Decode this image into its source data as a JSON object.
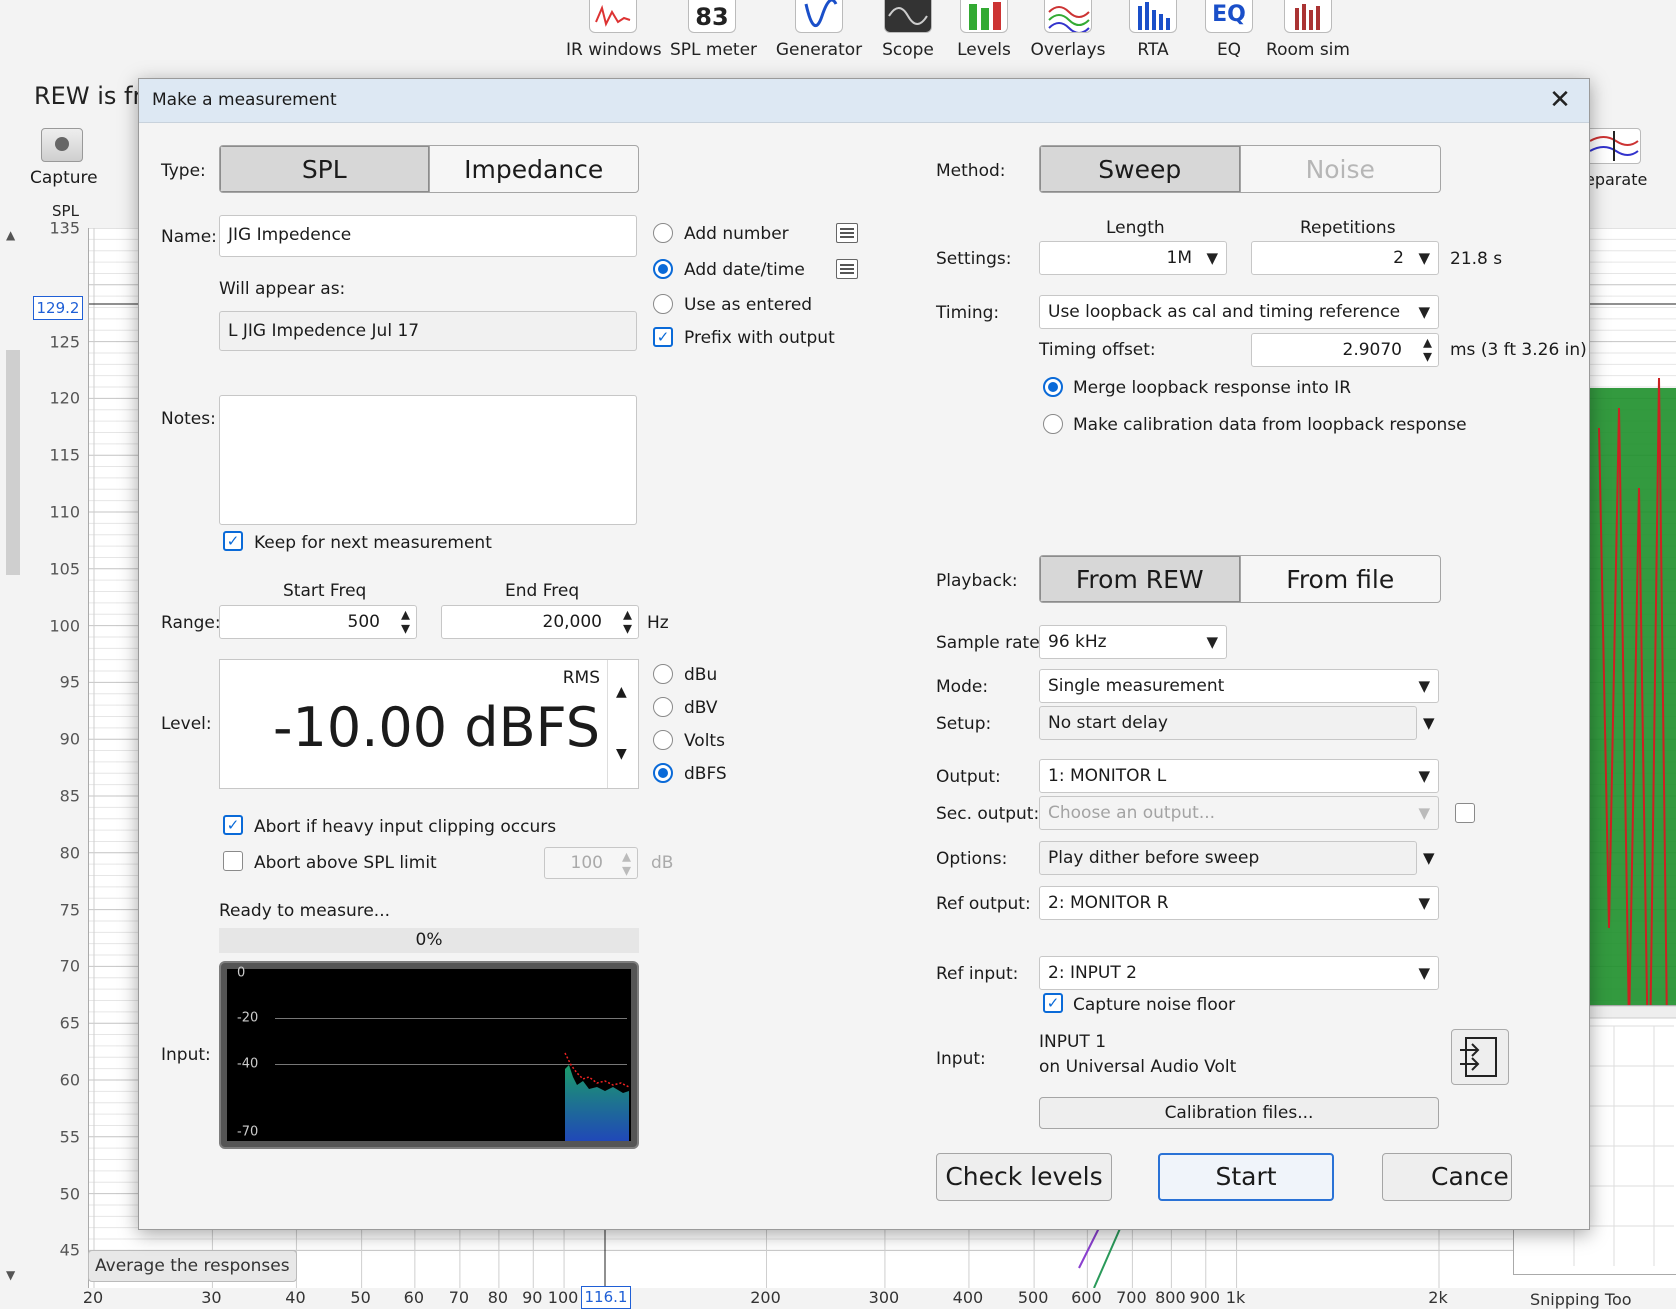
{
  "toolbar": {
    "items": [
      {
        "label": "IR windows",
        "icon": "ir-windows-icon"
      },
      {
        "label": "SPL meter",
        "icon": "spl-meter-icon",
        "value": "83"
      },
      {
        "label": "Generator",
        "icon": "generator-icon"
      },
      {
        "label": "Scope",
        "icon": "scope-icon"
      },
      {
        "label": "Levels",
        "icon": "levels-icon"
      },
      {
        "label": "Overlays",
        "icon": "overlays-icon"
      },
      {
        "label": "RTA",
        "icon": "rta-icon"
      },
      {
        "label": "EQ",
        "icon": "eq-icon"
      },
      {
        "label": "Room sim",
        "icon": "room-sim-icon"
      }
    ]
  },
  "background": {
    "banner": "REW is fr",
    "capture_label": "Capture",
    "separate_label": "eparate",
    "spl_label": "SPL",
    "cursor_y": "129.2",
    "cursor_x": "116.1",
    "average_button": "Average the responses",
    "y_ticks": [
      "135",
      "125",
      "120",
      "115",
      "110",
      "105",
      "100",
      "95",
      "90",
      "85",
      "80",
      "75",
      "70",
      "65",
      "60",
      "55",
      "50",
      "45"
    ],
    "x_ticks": [
      "20",
      "30",
      "40",
      "50",
      "60",
      "70",
      "80",
      "90",
      "100",
      "200",
      "300",
      "400",
      "500",
      "600",
      "700",
      "800",
      "900",
      "1k",
      "2k"
    ],
    "snipping_tool": "Snipping Too"
  },
  "dialog": {
    "title": "Make a measurement",
    "close": "✕",
    "type": {
      "label": "Type:",
      "options": [
        "SPL",
        "Impedance"
      ],
      "selected": "SPL"
    },
    "name": {
      "label": "Name:",
      "value": "JIG Impedence",
      "will_appear_label": "Will appear as:",
      "will_appear_value": "L JIG Impedence Jul 17"
    },
    "name_options": [
      {
        "label": "Add number",
        "checked": false
      },
      {
        "label": "Add date/time",
        "checked": true
      },
      {
        "label": "Use as entered",
        "checked": false
      }
    ],
    "prefix_with_output": {
      "label": "Prefix with output",
      "checked": true
    },
    "notes": {
      "label": "Notes:",
      "value": ""
    },
    "keep_for_next": {
      "label": "Keep for next measurement",
      "checked": true
    },
    "range": {
      "label": "Range:",
      "start_label": "Start Freq",
      "end_label": "End Freq",
      "start": "500",
      "end": "20,000",
      "unit": "Hz"
    },
    "level": {
      "label": "Level:",
      "mode": "RMS",
      "value": "-10.00 dBFS",
      "units": [
        {
          "label": "dBu",
          "checked": false
        },
        {
          "label": "dBV",
          "checked": false
        },
        {
          "label": "Volts",
          "checked": false
        },
        {
          "label": "dBFS",
          "checked": true
        }
      ]
    },
    "abort_clipping": {
      "label": "Abort if heavy input clipping occurs",
      "checked": true
    },
    "abort_spl": {
      "label": "Abort above SPL limit",
      "checked": false,
      "value": "100",
      "unit": "dB"
    },
    "status": "Ready to measure...",
    "progress": {
      "text": "0%",
      "fraction": 0
    },
    "input_label": "Input:",
    "meter_ticks": [
      "0",
      "-20",
      "-40",
      "-70"
    ],
    "method": {
      "label": "Method:",
      "options": [
        "Sweep",
        "Noise"
      ],
      "selected": "Sweep"
    },
    "settings": {
      "label": "Settings:",
      "length_label": "Length",
      "repetitions_label": "Repetitions",
      "length": "1M",
      "repetitions": "2",
      "duration": "21.8 s"
    },
    "timing": {
      "label": "Timing:",
      "value": "Use loopback as cal and timing reference",
      "offset_label": "Timing offset:",
      "offset": "2.9070",
      "offset_unit": "ms (3 ft 3.26 in)"
    },
    "loopback_options": [
      {
        "label": "Merge loopback response into IR",
        "checked": true
      },
      {
        "label": "Make calibration data from loopback response",
        "checked": false
      }
    ],
    "playback": {
      "label": "Playback:",
      "options": [
        "From REW",
        "From file"
      ],
      "selected": "From REW"
    },
    "sample_rate": {
      "label": "Sample rate:",
      "value": "96 kHz"
    },
    "mode": {
      "label": "Mode:",
      "value": "Single measurement"
    },
    "setup": {
      "label": "Setup:",
      "value": "No start delay"
    },
    "output": {
      "label": "Output:",
      "value": "1: MONITOR L"
    },
    "sec_output": {
      "label": "Sec. output:",
      "placeholder": "Choose an output..."
    },
    "options": {
      "label": "Options:",
      "value": "Play dither before sweep"
    },
    "ref_output": {
      "label": "Ref output:",
      "value": "2: MONITOR R"
    },
    "ref_input": {
      "label": "Ref input:",
      "value": "2: INPUT 2"
    },
    "capture_noise_floor": {
      "label": "Capture noise floor",
      "checked": true
    },
    "input": {
      "label": "Input:",
      "line1": "INPUT 1",
      "line2": "on Universal Audio Volt"
    },
    "calibration_button": "Calibration files...",
    "buttons": {
      "check_levels": "Check levels",
      "start": "Start",
      "cancel": "Cancel"
    }
  }
}
